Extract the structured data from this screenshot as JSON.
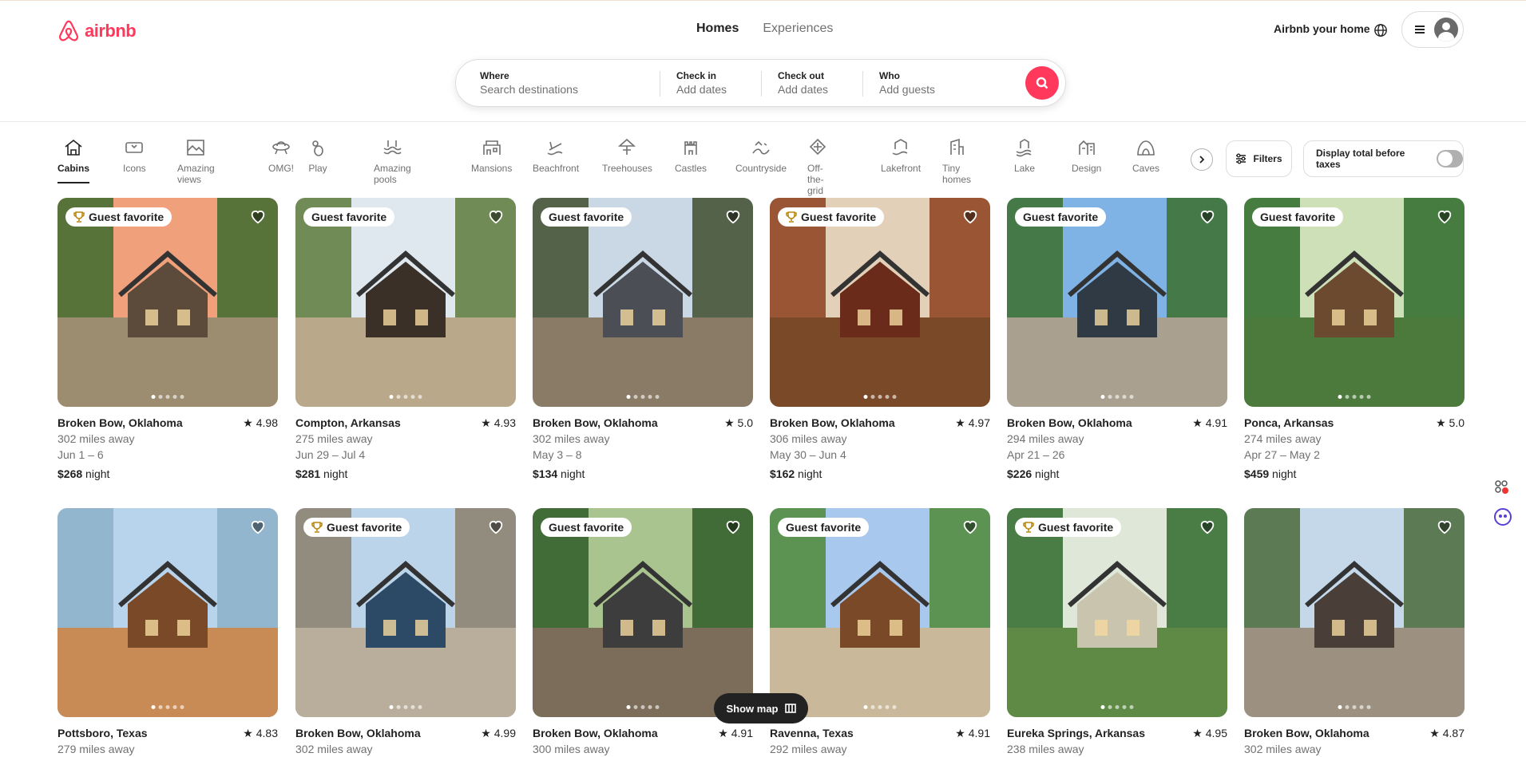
{
  "brand": {
    "name": "airbnb",
    "color": "#ff385c"
  },
  "nav": {
    "tabs": [
      {
        "label": "Homes"
      },
      {
        "label": "Experiences"
      }
    ]
  },
  "header": {
    "host_link": "Airbnb your home"
  },
  "search": {
    "where_label": "Where",
    "where_placeholder": "Search destinations",
    "checkin_label": "Check in",
    "checkin_value": "Add dates",
    "checkout_label": "Check out",
    "checkout_value": "Add dates",
    "who_label": "Who",
    "who_value": "Add guests"
  },
  "categories": [
    {
      "label": "Cabins",
      "icon": "cabin-icon"
    },
    {
      "label": "Icons",
      "icon": "ticket-icon"
    },
    {
      "label": "Amazing views",
      "icon": "views-icon"
    },
    {
      "label": "OMG!",
      "icon": "ufo-icon"
    },
    {
      "label": "Play",
      "icon": "bowling-icon"
    },
    {
      "label": "Amazing pools",
      "icon": "pool-icon"
    },
    {
      "label": "Mansions",
      "icon": "mansion-icon"
    },
    {
      "label": "Beachfront",
      "icon": "beach-icon"
    },
    {
      "label": "Treehouses",
      "icon": "treehouse-icon"
    },
    {
      "label": "Castles",
      "icon": "castle-icon"
    },
    {
      "label": "Countryside",
      "icon": "countryside-icon"
    },
    {
      "label": "Off-the-grid",
      "icon": "offgrid-icon"
    },
    {
      "label": "Lakefront",
      "icon": "lakefront-icon"
    },
    {
      "label": "Tiny homes",
      "icon": "tinyhome-icon"
    },
    {
      "label": "Lake",
      "icon": "lake-icon"
    },
    {
      "label": "Design",
      "icon": "design-icon"
    },
    {
      "label": "Caves",
      "icon": "cave-icon"
    }
  ],
  "filters": {
    "label": "Filters",
    "tax_label": "Display total before taxes"
  },
  "listings": [
    {
      "location": "Broken Bow, Oklahoma",
      "rating": "4.98",
      "distance": "302 miles away",
      "dates": "Jun 1 – 6",
      "price": "$268",
      "badge": "Guest favorite",
      "trophy": true
    },
    {
      "location": "Compton, Arkansas",
      "rating": "4.93",
      "distance": "275 miles away",
      "dates": "Jun 29 – Jul 4",
      "price": "$281",
      "badge": "Guest favorite",
      "trophy": false
    },
    {
      "location": "Broken Bow, Oklahoma",
      "rating": "5.0",
      "distance": "302 miles away",
      "dates": "May 3 – 8",
      "price": "$134",
      "badge": "Guest favorite",
      "trophy": false
    },
    {
      "location": "Broken Bow, Oklahoma",
      "rating": "4.97",
      "distance": "306 miles away",
      "dates": "May 30 – Jun 4",
      "price": "$162",
      "badge": "Guest favorite",
      "trophy": true
    },
    {
      "location": "Broken Bow, Oklahoma",
      "rating": "4.91",
      "distance": "294 miles away",
      "dates": "Apr 21 – 26",
      "price": "$226",
      "badge": "Guest favorite",
      "trophy": false
    },
    {
      "location": "Ponca, Arkansas",
      "rating": "5.0",
      "distance": "274 miles away",
      "dates": "Apr 27 – May 2",
      "price": "$459",
      "badge": "Guest favorite",
      "trophy": false
    },
    {
      "location": "Pottsboro, Texas",
      "rating": "4.83",
      "distance": "279 miles away",
      "badge": ""
    },
    {
      "location": "Broken Bow, Oklahoma",
      "rating": "4.99",
      "distance": "302 miles away",
      "badge": "Guest favorite",
      "trophy": true
    },
    {
      "location": "Broken Bow, Oklahoma",
      "rating": "4.91",
      "distance": "300 miles away",
      "badge": "Guest favorite",
      "trophy": false
    },
    {
      "location": "Ravenna, Texas",
      "rating": "4.91",
      "distance": "292 miles away",
      "badge": "Guest favorite",
      "trophy": false
    },
    {
      "location": "Eureka Springs, Arkansas",
      "rating": "4.95",
      "distance": "238 miles away",
      "badge": "Guest favorite",
      "trophy": true
    },
    {
      "location": "Broken Bow, Oklahoma",
      "rating": "4.87",
      "distance": "302 miles away",
      "badge": ""
    }
  ],
  "price_suffix": "night",
  "show_map": {
    "label": "Show map"
  }
}
